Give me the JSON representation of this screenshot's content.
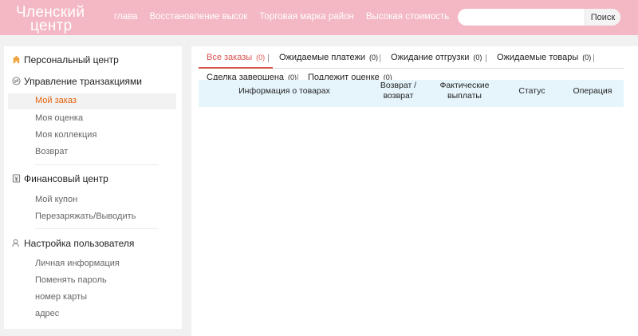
{
  "header": {
    "logo_line1": "Членский",
    "logo_line2": "центр",
    "nav": [
      "глава",
      "Восстановление высок",
      "Торговая марка район",
      "Высокая стоимость"
    ],
    "search": {
      "placeholder": "",
      "button_label": "Поиск"
    },
    "colors": {
      "header_bg": "#f3b8c3",
      "accent": "#e6630e",
      "tab_active": "#d9534f",
      "table_head_bg": "#e6f5fc"
    }
  },
  "sidebar": {
    "personal_center": {
      "label": "Персональный центр",
      "icon": "home-icon"
    },
    "transactions": {
      "label": "Управление транзакциями",
      "icon": "transactions-icon",
      "items": [
        "Мой заказ",
        "Моя оценка",
        "Моя коллекция",
        "Возврат"
      ],
      "active": "Мой заказ"
    },
    "finance": {
      "label": "Финансовый центр",
      "icon": "finance-icon",
      "items": [
        "Мой купон",
        "Перезаряжать/Выводить"
      ]
    },
    "user_settings": {
      "label": "Настройка пользователя",
      "icon": "user-icon",
      "items": [
        "Личная информация",
        "Поменять пароль",
        "номер карты",
        "адрес"
      ]
    }
  },
  "order_tabs": [
    {
      "label": "Все заказы",
      "count": "(0)"
    },
    {
      "label": "Ожидаемые платежи",
      "count": "(0)"
    },
    {
      "label": "Ожидание отгрузки",
      "count": "(0)"
    },
    {
      "label": "Ожидаемые товары",
      "count": "(0)"
    },
    {
      "label": "Сделка завершена",
      "count": "(0)"
    },
    {
      "label": "Подлежит оценке",
      "count": "(0)"
    }
  ],
  "table": {
    "columns": [
      "Информация о товарах",
      "Возврат / возврат",
      "Фактические выплаты",
      "Статус",
      "Операция"
    ]
  }
}
